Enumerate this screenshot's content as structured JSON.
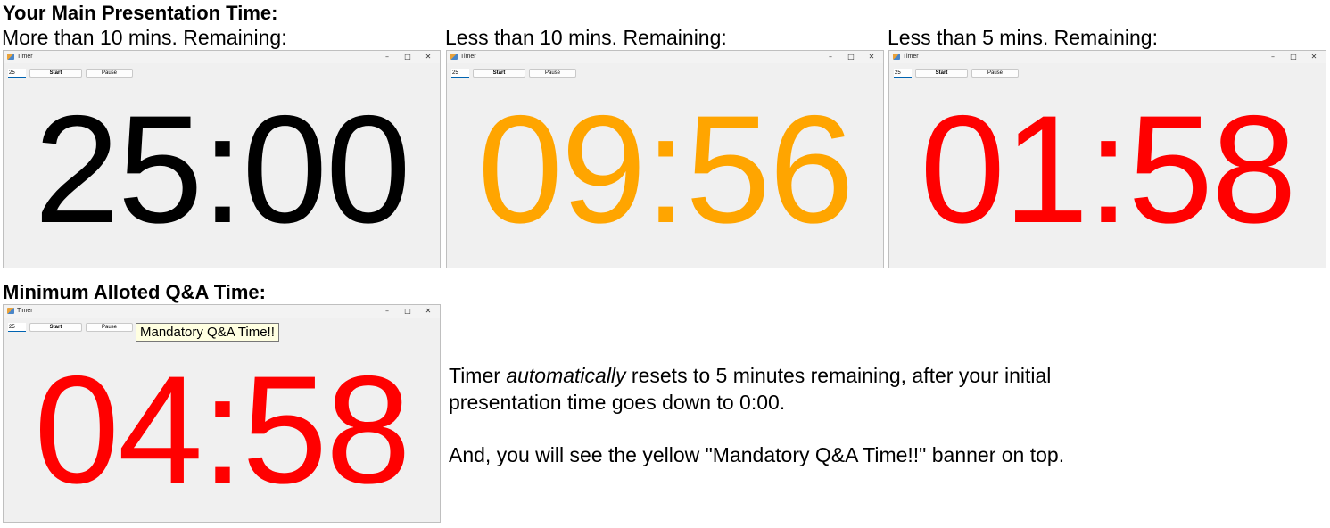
{
  "headings": {
    "main": "Your Main Presentation Time:",
    "qa": "Minimum Alloted Q&A Time:"
  },
  "captions": {
    "more10": "More than 10 mins. Remaining:",
    "less10": "Less than 10 mins. Remaining:",
    "less5": "Less than 5 mins. Remaining:"
  },
  "windows": [
    {
      "title": "Timer",
      "minutes_input": "25",
      "start_label": "Start",
      "pause_label": "Pause",
      "time": "25:00",
      "color": "#000000"
    },
    {
      "title": "Timer",
      "minutes_input": "25",
      "start_label": "Start",
      "pause_label": "Pause",
      "time": "09:56",
      "color": "#ffa500"
    },
    {
      "title": "Timer",
      "minutes_input": "25",
      "start_label": "Start",
      "pause_label": "Pause",
      "time": "01:58",
      "color": "#ff0000"
    },
    {
      "title": "Timer",
      "minutes_input": "25",
      "start_label": "Start",
      "pause_label": "Pause",
      "time": "04:58",
      "color": "#ff0000",
      "banner": "Mandatory Q&A Time!!"
    }
  ],
  "window_controls": {
    "minimize": "–",
    "maximize": "□",
    "close": "✕"
  },
  "description": {
    "line1_pre": "Timer ",
    "line1_em": "automatically",
    "line1_post": " resets to 5 minutes remaining, after your initial",
    "line2": "presentation time goes down to 0:00.",
    "line3": "And, you will see the yellow \"Mandatory Q&A Time!!\" banner on top."
  },
  "icons": [
    "app-icon",
    "minimize-icon",
    "maximize-icon",
    "close-icon"
  ]
}
